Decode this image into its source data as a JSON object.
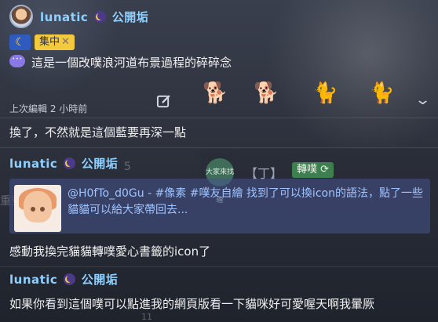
{
  "header": {
    "user_name": "lunatic",
    "user_suffix": "公開垢",
    "badge_moon": "☾",
    "badge_focus": "集中",
    "badge_focus_close": "✕",
    "title": "這是一個改噗浪河道布景過程的碎碎念"
  },
  "meta": {
    "edited": "上次編輯 2 小時前"
  },
  "stickers": [
    "🐕",
    "🐕",
    "🐈",
    "🐈"
  ],
  "responses": [
    {
      "text": "換了，不然就是這個藍要再深一點"
    },
    {
      "user_name": "lunatic",
      "user_suffix": "公開垢",
      "link_text": "@H0fTo_d0Gu - #像素 #噗友自繪 找到了可以換icon的語法，點了一些貓貓可以給大家帶回去...",
      "text": "感動我換完貓貓轉噗愛心書籤的icon了"
    },
    {
      "user_name": "lunatic",
      "user_suffix": "公開垢",
      "text": "如果你看到這個噗可以點進我的網頁版看一下貓咪好可愛喔天啊我暈厥"
    }
  ],
  "background_card": {
    "avatar_text": "大家來找碴",
    "name": "【丁】",
    "replurk_label": "轉噗"
  },
  "faint": {
    "five": "5",
    "left_fragment": "重登",
    "eleven": "11"
  },
  "colors": {
    "accent_name": "#8ed0ff",
    "link": "#9fc4ff",
    "focus_badge": "#f3c93d",
    "replurk_badge": "#3e7f4f"
  }
}
